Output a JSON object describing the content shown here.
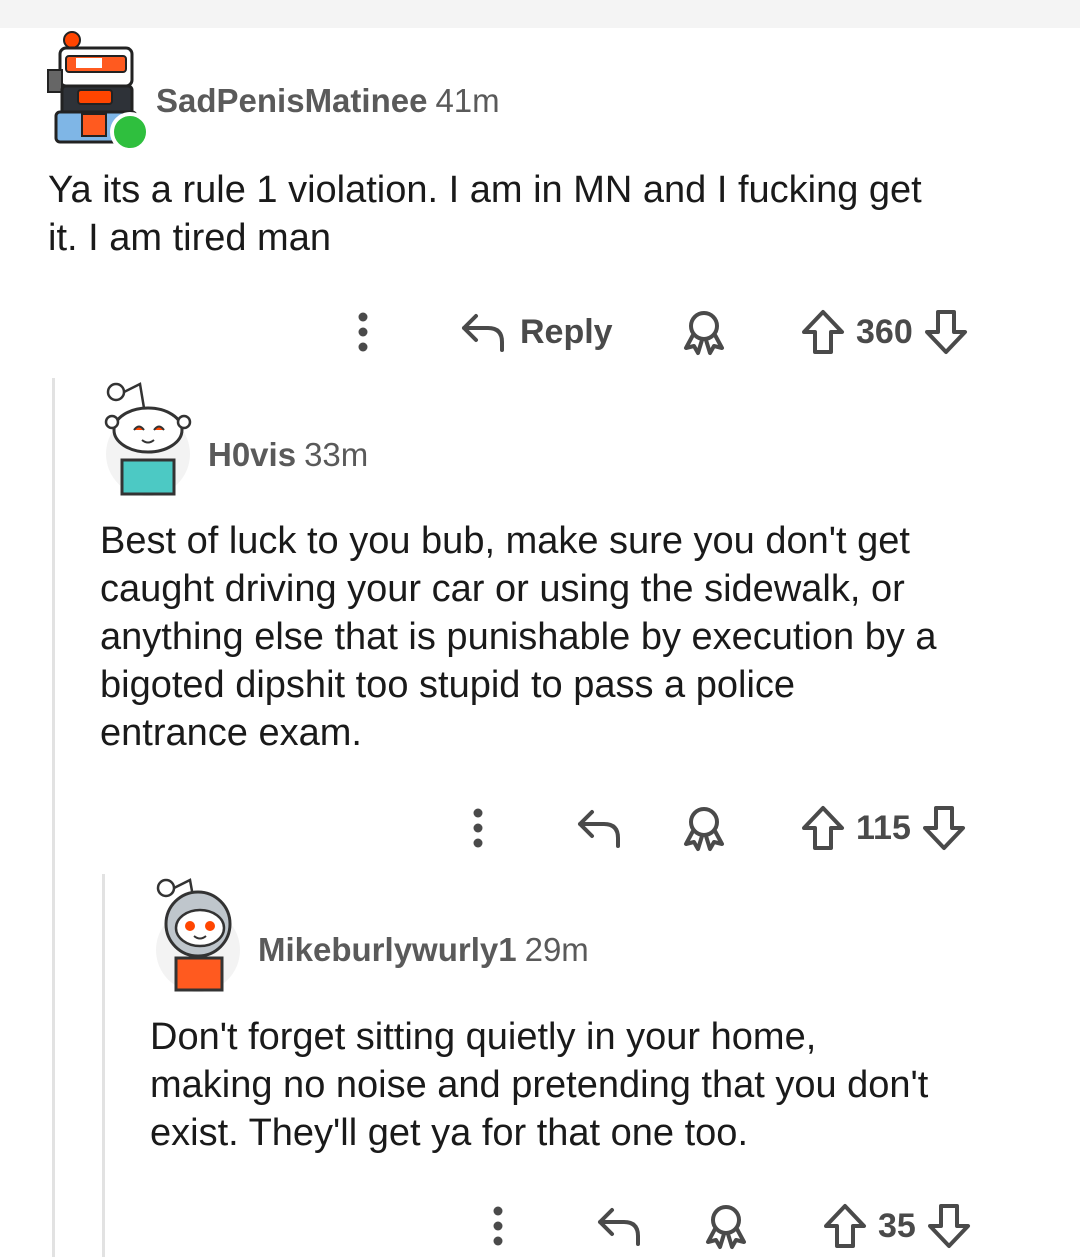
{
  "comments": [
    {
      "username": "SadPenisMatinee",
      "time": "41m",
      "body_lines": [
        "Ya its a rule 1 violation. I am in MN and I fucking get",
        "it. I am tired man"
      ],
      "reply_label": "Reply",
      "votes": "360",
      "online": true
    },
    {
      "username": "H0vis",
      "time": "33m",
      "body_lines": [
        "Best of luck to you bub, make sure you don't get",
        "caught driving your car or using the sidewalk, or",
        "anything else that is punishable by execution by a",
        "bigoted dipshit too stupid to pass a police",
        "entrance exam."
      ],
      "votes": "115"
    },
    {
      "username": "Mikeburlywurly1",
      "time": "29m",
      "body_lines": [
        "Don't forget sitting quietly in your home,",
        "making no noise and pretending that you don't",
        "exist. They'll get ya for that one too."
      ],
      "votes": "35"
    }
  ],
  "colors": {
    "text": "#1a1a1a",
    "meta": "#5a5a5a",
    "icon": "#4a4a4a",
    "online": "#2fbf3e",
    "snoo_orange": "#ff4500",
    "thread_line": "#e2e2e2"
  },
  "icons": [
    "more-icon",
    "reply-icon",
    "award-icon",
    "upvote-icon",
    "downvote-icon"
  ]
}
